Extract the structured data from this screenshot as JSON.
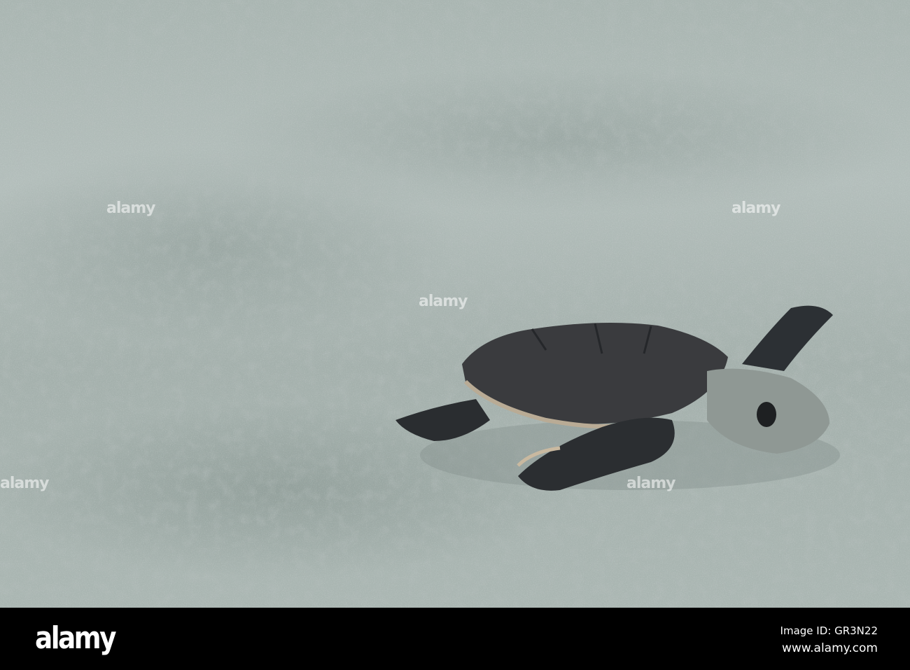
{
  "photo": {
    "subject": "sea-turtle-hatchling"
  },
  "watermark": {
    "logo": "alamy",
    "image_id": "Image ID: GR3N22",
    "url": "www.alamy.com"
  }
}
